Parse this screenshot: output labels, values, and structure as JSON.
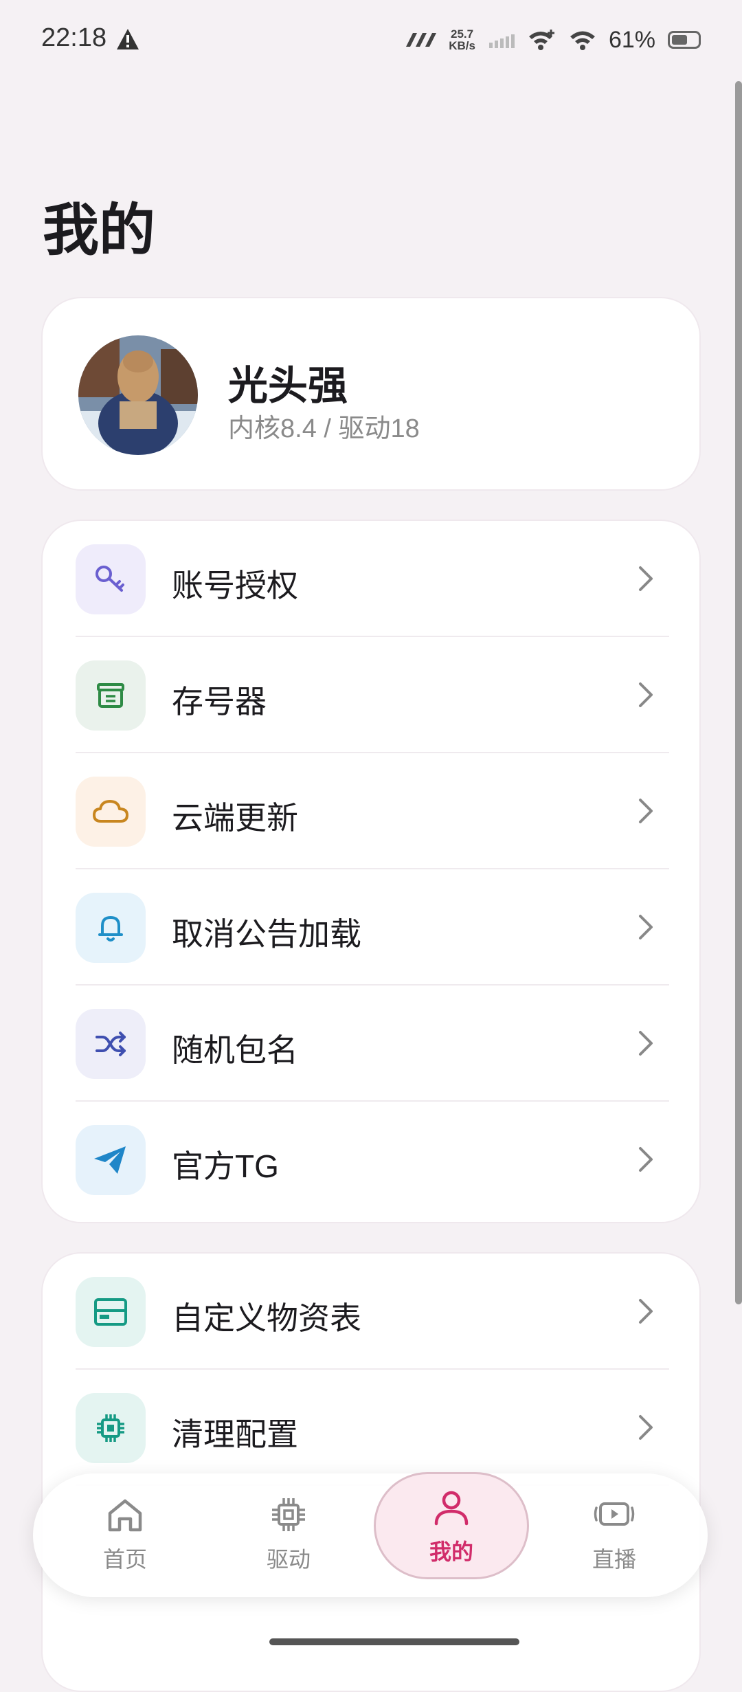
{
  "status_bar": {
    "time": "22:18",
    "net_speed_value": "25.7",
    "net_speed_unit": "KB/s",
    "battery": "61%",
    "icons": [
      "alert-icon",
      "nfc-icon",
      "signal-icon",
      "wifi-plus-icon",
      "wifi-icon",
      "battery-icon"
    ]
  },
  "page": {
    "title": "我的"
  },
  "profile": {
    "name": "光头强",
    "subtitle": "内核8.4 / 驱动18"
  },
  "menu_group_1": [
    {
      "label": "账号授权",
      "icon": "key-icon",
      "accent": "#6a5fd0",
      "bg": "#efecfb"
    },
    {
      "label": "存号器",
      "icon": "archive-icon",
      "accent": "#2e8b45",
      "bg": "#eaf2ec"
    },
    {
      "label": "云端更新",
      "icon": "cloud-icon",
      "accent": "#c8861f",
      "bg": "#fdf1e6"
    },
    {
      "label": "取消公告加载",
      "icon": "bell-icon",
      "accent": "#1f8fc8",
      "bg": "#e6f3fb"
    },
    {
      "label": "随机包名",
      "icon": "shuffle-icon",
      "accent": "#3f4fb0",
      "bg": "#eeeef9"
    },
    {
      "label": "官方TG",
      "icon": "telegram-icon",
      "accent": "#1f86c8",
      "bg": "#e6f2fb"
    }
  ],
  "menu_group_2": [
    {
      "label": "自定义物资表",
      "icon": "card-icon",
      "accent": "#159a84",
      "bg": "#e4f4f1"
    },
    {
      "label": "清理配置",
      "icon": "chip-icon",
      "accent": "#159a84",
      "bg": "#e4f4f1"
    }
  ],
  "bottom_nav": [
    {
      "label": "首页",
      "icon": "home-icon",
      "active": false
    },
    {
      "label": "驱动",
      "icon": "chip-icon",
      "active": false
    },
    {
      "label": "我的",
      "icon": "person-icon",
      "active": true
    },
    {
      "label": "直播",
      "icon": "video-icon",
      "active": false
    }
  ],
  "colors": {
    "accent": "#d12c6a",
    "background": "#f5f1f4"
  }
}
